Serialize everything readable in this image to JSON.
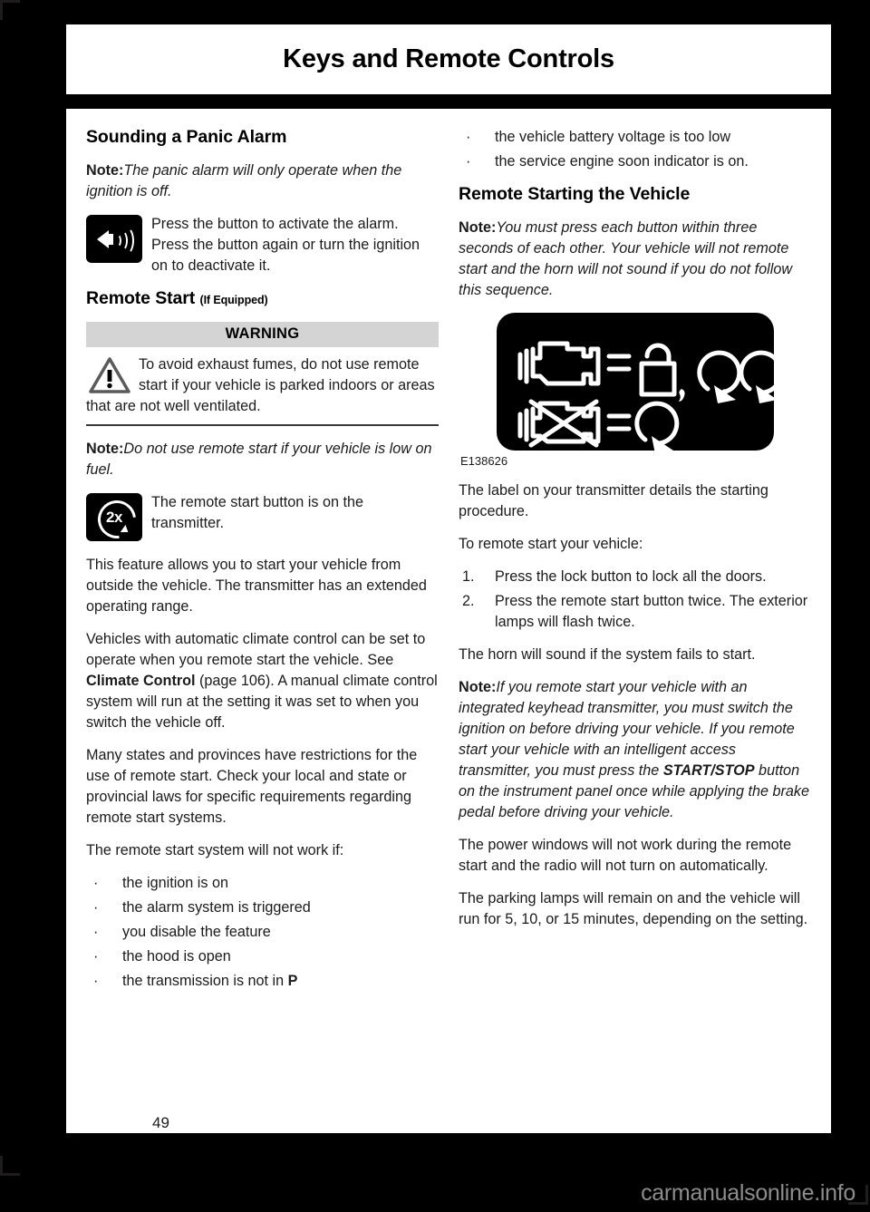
{
  "header": {
    "title": "Keys and Remote Controls"
  },
  "left_column": {
    "panic_heading": "Sounding a Panic Alarm",
    "panic_note_label": "Note:",
    "panic_note_text": "The panic alarm will only operate when the ignition is off.",
    "panic_icon_name": "panic-horn-icon",
    "panic_icon_text": "Press the button to activate the alarm. Press the button again or turn the ignition on to deactivate it.",
    "remote_start_heading": "Remote Start",
    "remote_start_qualifier": "(If Equipped)",
    "warning_title": "WARNING",
    "warning_text": "To avoid exhaust fumes, do not use remote start if your vehicle is parked indoors or areas that are not well ventilated.",
    "fuel_note_label": "Note:",
    "fuel_note_text": "Do not use remote start if your vehicle is low on fuel.",
    "twox_icon_label": "2x",
    "twox_icon_text": "The remote start button is on the transmitter.",
    "para_feature": "This feature allows you to start your vehicle from outside the vehicle. The transmitter has an extended operating range.",
    "para_climate_1": "Vehicles with automatic climate control can be set to operate when you remote start the vehicle.  See ",
    "para_climate_link": "Climate Control",
    "para_climate_2": " (page 106).  A manual climate control system will run at the setting it was set to when you switch the vehicle off.",
    "para_states": "Many states and provinces have restrictions for the use of remote start. Check your local and state or provincial laws for specific requirements regarding remote start systems.",
    "not_work_intro": "The remote start system will not work if:",
    "not_work_bullets": [
      "the ignition is on",
      "the alarm system is triggered",
      "you disable the feature",
      "the hood is open"
    ],
    "last_bullet_prefix": "the transmission is not in ",
    "last_bullet_bold": "P",
    "bullet_glyph": "·"
  },
  "right_column": {
    "continued_bullets": [
      "the vehicle battery voltage is too low",
      "the service engine soon indicator is on."
    ],
    "remote_starting_heading": "Remote Starting the Vehicle",
    "sequence_note_label": "Note:",
    "sequence_note_text": "You must press each button within three seconds of each other. Your vehicle will not remote start and the horn will not sound if you do not follow this sequence.",
    "figure_caption": "E138626",
    "figure_name": "transmitter-label-diagram",
    "figure_row1_description": "engine = lock, remote start, remote start",
    "figure_row2_description": "engine off = remote start",
    "para_label": "The label on your transmitter details the starting procedure.",
    "steps_intro": "To remote start your vehicle:",
    "steps": [
      {
        "num": "1.",
        "text": "Press the lock button to lock all the doors."
      },
      {
        "num": "2.",
        "text": "Press the remote start button twice. The exterior lamps will flash twice."
      }
    ],
    "para_horn": "The horn will sound if the system fails to start.",
    "keyhead_note_label": "Note:",
    "keyhead_note_1": "If you remote start your vehicle with an integrated keyhead transmitter, you must switch the ignition on before driving your vehicle. If you remote start your vehicle with an intelligent access transmitter, you must press the ",
    "keyhead_note_bold": "START/STOP",
    "keyhead_note_2": " button on the instrument panel once while applying the brake pedal before driving your vehicle.",
    "para_windows": "The power windows will not work during the remote start and the radio will not turn on automatically.",
    "para_parking": "The parking lamps will remain on and the vehicle will run for 5, 10, or 15 minutes, depending on the setting."
  },
  "footer": {
    "page_number": "49",
    "watermark": "carmanualsonline.info"
  },
  "colors": {
    "page_background": "#000000",
    "paper": "#ffffff",
    "text": "#1b1b1b",
    "warning_header_bg": "#d4d4d4",
    "watermark": "#8c8c8c"
  }
}
